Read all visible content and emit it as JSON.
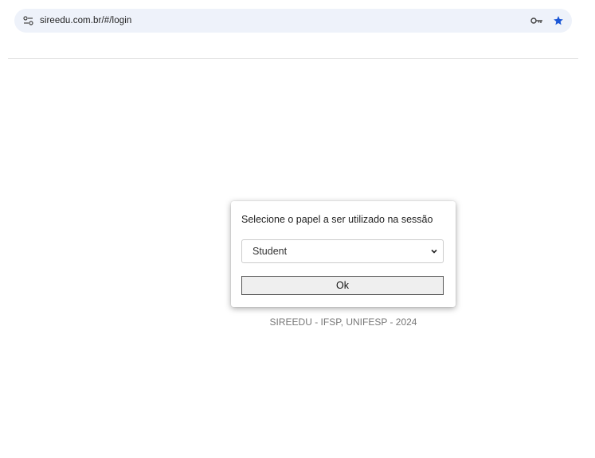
{
  "browser": {
    "url": "sireedu.com.br/#/login"
  },
  "dialog": {
    "title": "Selecione o papel a ser utilizado na sessão",
    "role_select": {
      "selected": "Student"
    },
    "ok_label": "Ok"
  },
  "footer": {
    "text": "SIREEDU - IFSP, UNIFESP - 2024"
  },
  "icons": {
    "site_info": "tune-icon",
    "password": "key-icon",
    "bookmark": "star-icon"
  },
  "colors": {
    "omnibox_bg": "#eef2fa",
    "star": "#1a56d6",
    "footer_text": "#777777"
  }
}
